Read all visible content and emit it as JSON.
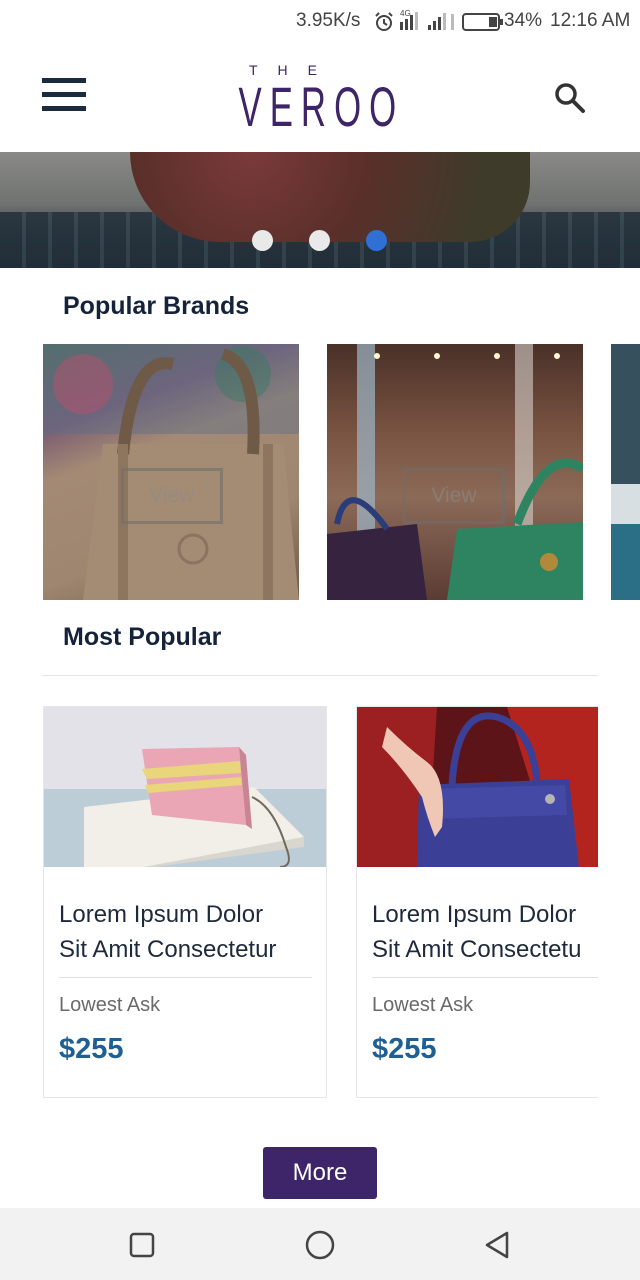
{
  "status_bar": {
    "speed": "3.95K/s",
    "network": "4G",
    "battery": "34%",
    "time": "12:16 AM",
    "icons": [
      "alarm-icon",
      "signal-icon",
      "battery-icon"
    ]
  },
  "header": {
    "logo_small": "THE",
    "logo_big": "VEROO",
    "menu_icon": "hamburger-menu-icon",
    "search_icon": "search-icon"
  },
  "hero": {
    "slide_count": 3,
    "active_slide": 3
  },
  "popular_brands": {
    "title": "Popular Brands",
    "items": [
      {
        "view_label": "View"
      },
      {
        "view_label": "View"
      },
      {
        "view_label": ""
      }
    ]
  },
  "most_popular": {
    "title": "Most Popular",
    "items": [
      {
        "name_line1": "Lorem Ipsum Dolor",
        "name_line2": "Sit Amit Consectetur",
        "ask_label": "Lowest Ask",
        "price": "$255"
      },
      {
        "name_line1": "Lorem Ipsum Dolor",
        "name_line2": "Sit Amit Consectetu",
        "ask_label": "Lowest Ask",
        "price": "$255"
      }
    ]
  },
  "more_button": {
    "label": "More"
  },
  "nav_bar": {
    "icons": [
      "recent-apps-icon",
      "home-icon",
      "back-icon"
    ]
  },
  "colors": {
    "brand": "#3e2468",
    "price": "#1f5f94",
    "active_dot": "#2f6fd6",
    "heading": "#15233a"
  }
}
